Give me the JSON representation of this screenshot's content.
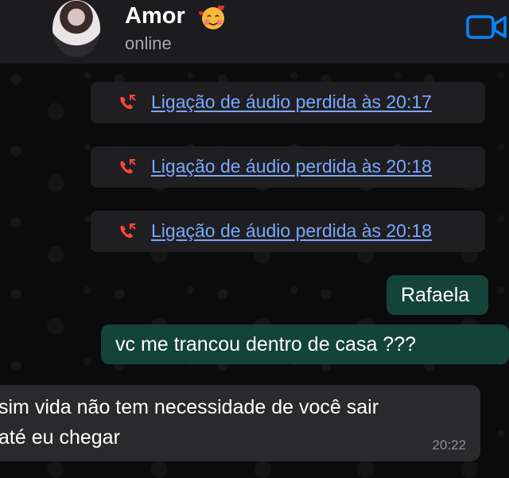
{
  "header": {
    "contact_name": "Amor",
    "status": "online",
    "emoji": "smiling-face-with-hearts",
    "video_icon": "video-camera-icon"
  },
  "calls": [
    {
      "label": "Ligação de áudio perdida às 20:17"
    },
    {
      "label": "Ligação de áudio perdida às 20:18"
    },
    {
      "label": "Ligação de áudio perdida às 20:18"
    }
  ],
  "messages_out": [
    {
      "text": "Rafaela"
    },
    {
      "text": "vc me trancou dentro de casa ???"
    }
  ],
  "message_in": {
    "line1": "sim vida não tem necessidade de você sair",
    "line2": "até eu chegar",
    "time": "20:22"
  },
  "colors": {
    "header_bg": "#1c1c1e",
    "chat_bg": "#0b0b0c",
    "call_pill_bg": "#1f1f21",
    "link_blue": "#7ba7ff",
    "missed_red": "#ff453a",
    "out_bubble": "#134437",
    "in_bubble": "#2a2a2c",
    "accent_blue": "#0a84ff"
  }
}
